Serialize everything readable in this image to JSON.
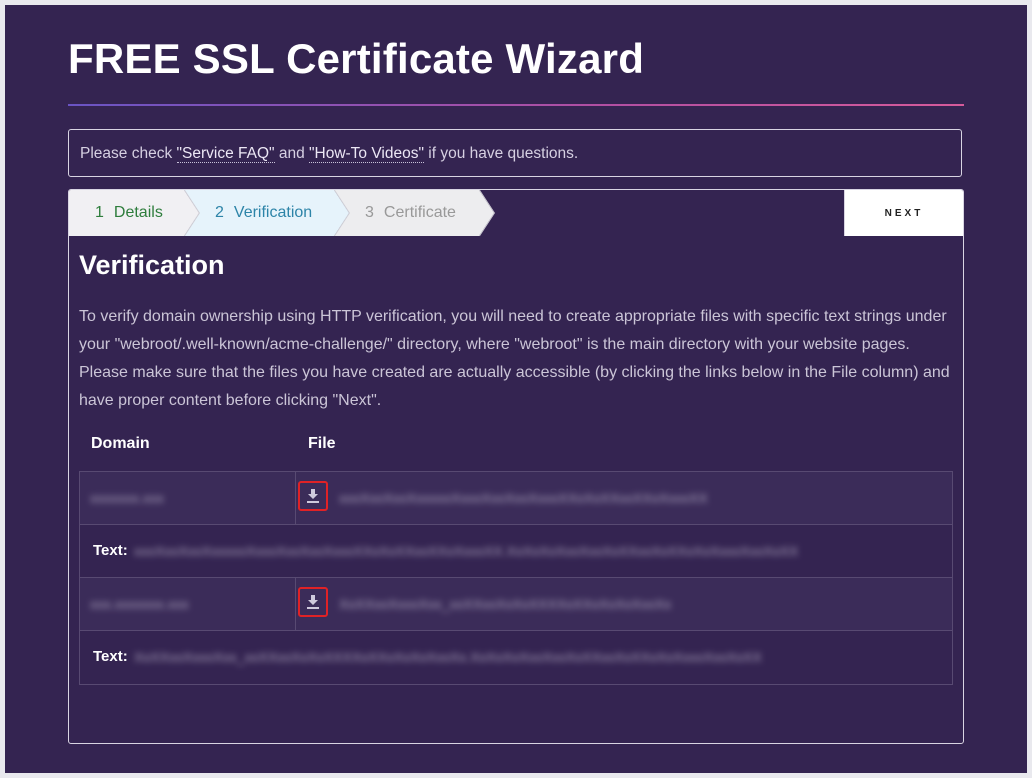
{
  "page": {
    "title": "FREE SSL Certificate Wizard"
  },
  "notice": {
    "prefix": "Please check ",
    "faq_link": "\"Service FAQ\"",
    "middle": " and ",
    "videos_link": "\"How-To Videos\"",
    "suffix": " if you have questions."
  },
  "steps": [
    {
      "number": "1",
      "label": "Details",
      "state": "completed",
      "color": "#2e7d3c"
    },
    {
      "number": "2",
      "label": "Verification",
      "state": "current",
      "color": "#2d84a8"
    },
    {
      "number": "3",
      "label": "Certificate",
      "state": "upcoming",
      "color": "#999999"
    }
  ],
  "next_button": {
    "label": "NEXT"
  },
  "verification": {
    "title": "Verification",
    "instructions": "To verify domain ownership using HTTP verification, you will need to create appropriate files with specific text strings under your \"webroot/.well-known/acme-challenge/\" directory, where \"webroot\" is the main directory with your website pages. Please make sure that the files you have created are actually accessible (by clicking the links below in the File column) and have proper content before clicking \"Next\".",
    "columns": {
      "domain": "Domain",
      "file": "File"
    },
    "text_label": "Text:",
    "entries": [
      {
        "domain": "[redacted]",
        "file": "[redacted]",
        "text": "[redacted]",
        "download_icon": "download-icon"
      },
      {
        "domain": "[redacted]",
        "file": "[redacted]",
        "text": "[redacted]",
        "download_icon": "download-icon"
      }
    ]
  },
  "colors": {
    "background": "#342451",
    "accent_gradient_start": "#6a54c4",
    "accent_gradient_end": "#d65b9b",
    "highlight_border": "#e02226"
  }
}
